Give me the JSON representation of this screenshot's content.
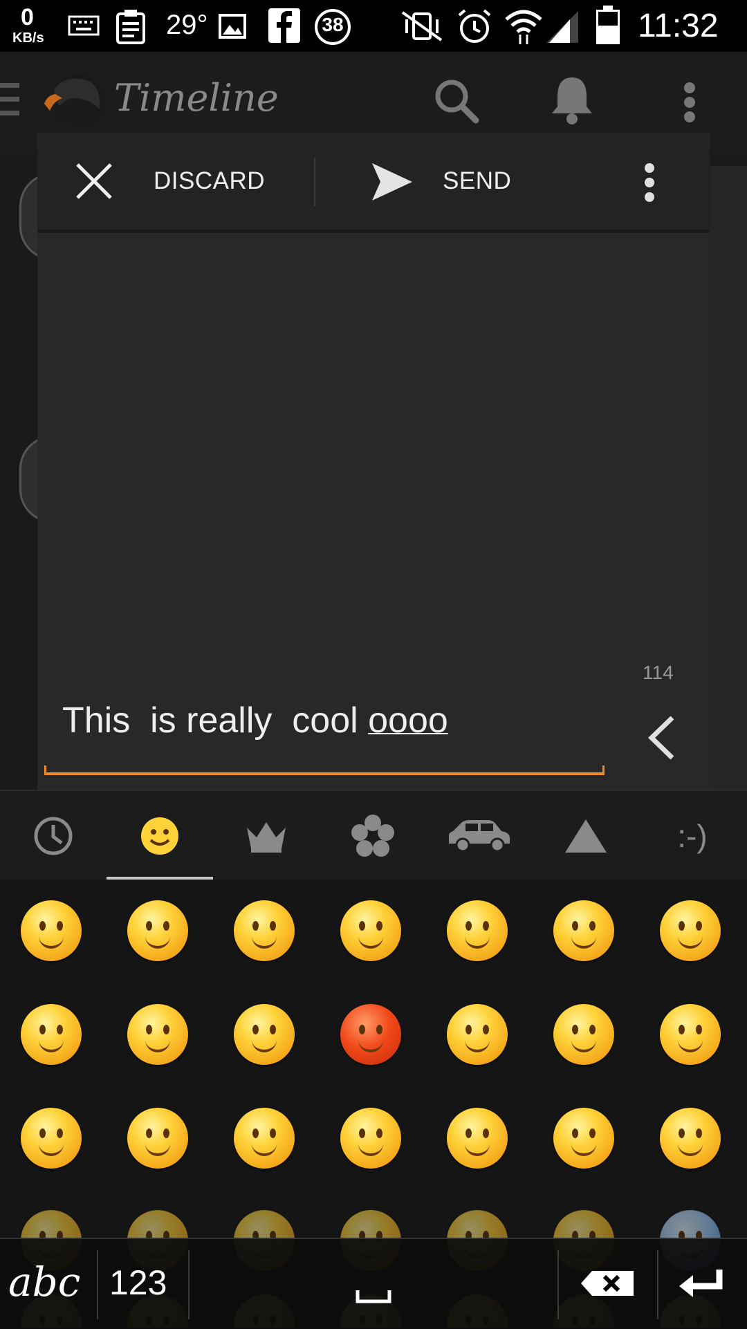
{
  "status_bar": {
    "net_speed": "0",
    "net_unit": "KB/s",
    "temperature": "29°",
    "notification_count": "38",
    "time": "11:32"
  },
  "app_bar": {
    "title": "Timeline"
  },
  "compose_dialog": {
    "discard_label": "DISCARD",
    "send_label": "SEND",
    "char_counter": "114",
    "text_plain": "This  is really  cool ",
    "text_composing": "oooo",
    "accent_color": "#f08a24"
  },
  "emoji_keyboard": {
    "tabs": [
      "recent-icon",
      "smiley-icon",
      "crown-icon",
      "flower-icon",
      "car-icon",
      "triangle-icon"
    ],
    "emoticon_tab_label": ":-)",
    "selected_tab": 1
  },
  "keyboard_bar": {
    "abc_label": "abc",
    "num_label": "123"
  }
}
